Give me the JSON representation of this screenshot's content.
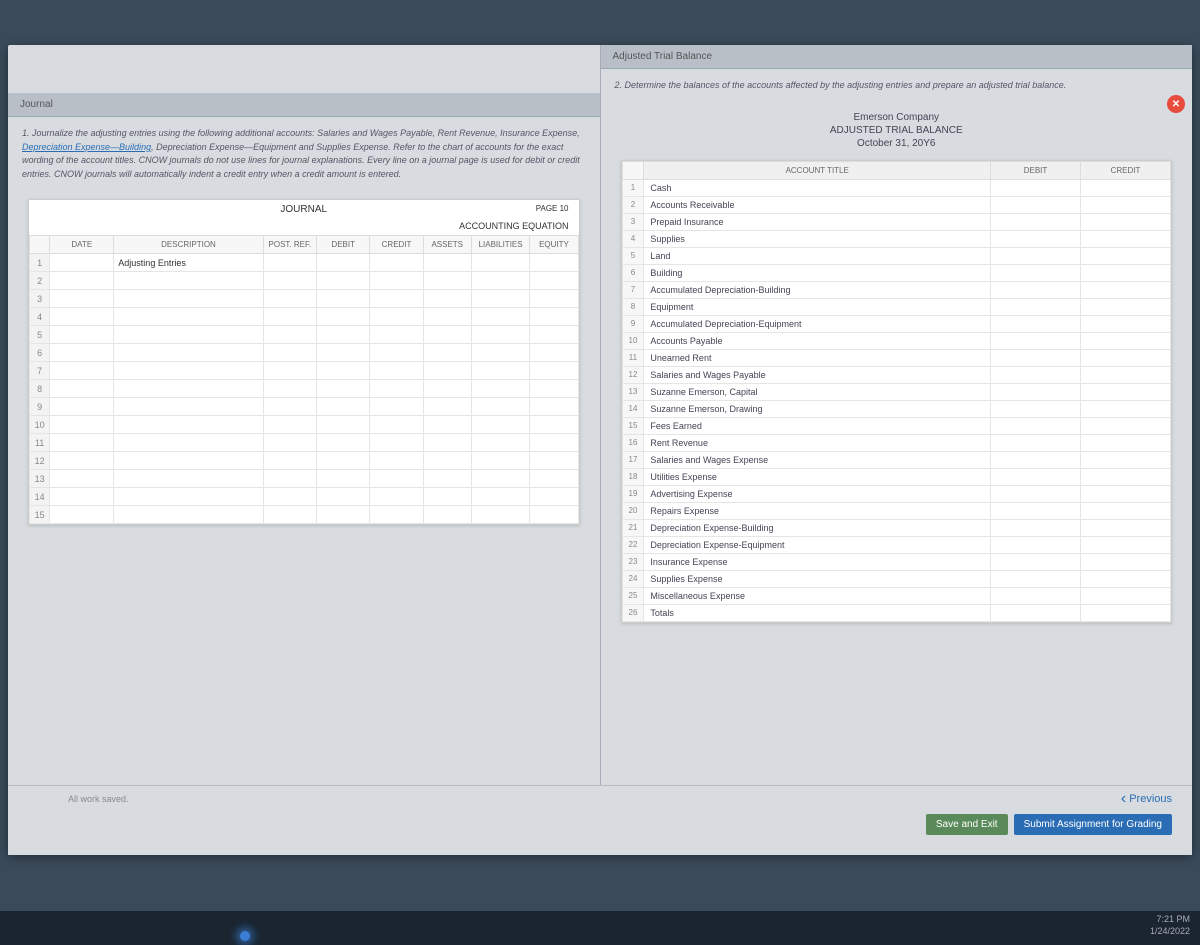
{
  "left": {
    "header": "Journal",
    "instructions_a": "1. Journalize the adjusting entries using the following additional accounts: Salaries and Wages Payable, Rent Revenue, Insurance Expense, ",
    "instructions_link": "Depreciation Expense—Building",
    "instructions_b": ", Depreciation Expense—Equipment and Supplies Expense. Refer to the chart of accounts for the exact wording of the account titles. CNOW journals do not use lines for journal explanations. Every line on a journal page is used for debit or credit entries. CNOW journals will automatically indent a credit entry when a credit amount is entered.",
    "journal_title": "JOURNAL",
    "page_label": "PAGE 10",
    "eq_label": "ACCOUNTING EQUATION",
    "cols": {
      "date": "DATE",
      "desc": "DESCRIPTION",
      "post": "POST. REF.",
      "debit": "DEBIT",
      "credit": "CREDIT",
      "assets": "ASSETS",
      "liab": "LIABILITIES",
      "equity": "EQUITY"
    },
    "first_row_desc": "Adjusting Entries"
  },
  "right": {
    "header": "Adjusted Trial Balance",
    "instructions": "2. Determine the balances of the accounts affected by the adjusting entries and prepare an adjusted trial balance.",
    "company": "Emerson Company",
    "title": "ADJUSTED TRIAL BALANCE",
    "date": "October 31, 20Y6",
    "cols": {
      "acct": "ACCOUNT TITLE",
      "debit": "DEBIT",
      "credit": "CREDIT"
    },
    "rows": [
      "Cash",
      "Accounts Receivable",
      "Prepaid Insurance",
      "Supplies",
      "Land",
      "Building",
      "Accumulated Depreciation-Building",
      "Equipment",
      "Accumulated Depreciation-Equipment",
      "Accounts Payable",
      "Unearned Rent",
      "Salaries and Wages Payable",
      "Suzanne Emerson, Capital",
      "Suzanne Emerson, Drawing",
      "Fees Earned",
      "Rent Revenue",
      "Salaries and Wages Expense",
      "Utilities Expense",
      "Advertising Expense",
      "Repairs Expense",
      "Depreciation Expense-Building",
      "Depreciation Expense-Equipment",
      "Insurance Expense",
      "Supplies Expense",
      "Miscellaneous Expense",
      "Totals"
    ]
  },
  "footer": {
    "saved": "All work saved.",
    "previous": "Previous",
    "save_exit": "Save and Exit",
    "submit": "Submit Assignment for Grading"
  },
  "taskbar": {
    "time": "7:21 PM",
    "date": "1/24/2022"
  }
}
